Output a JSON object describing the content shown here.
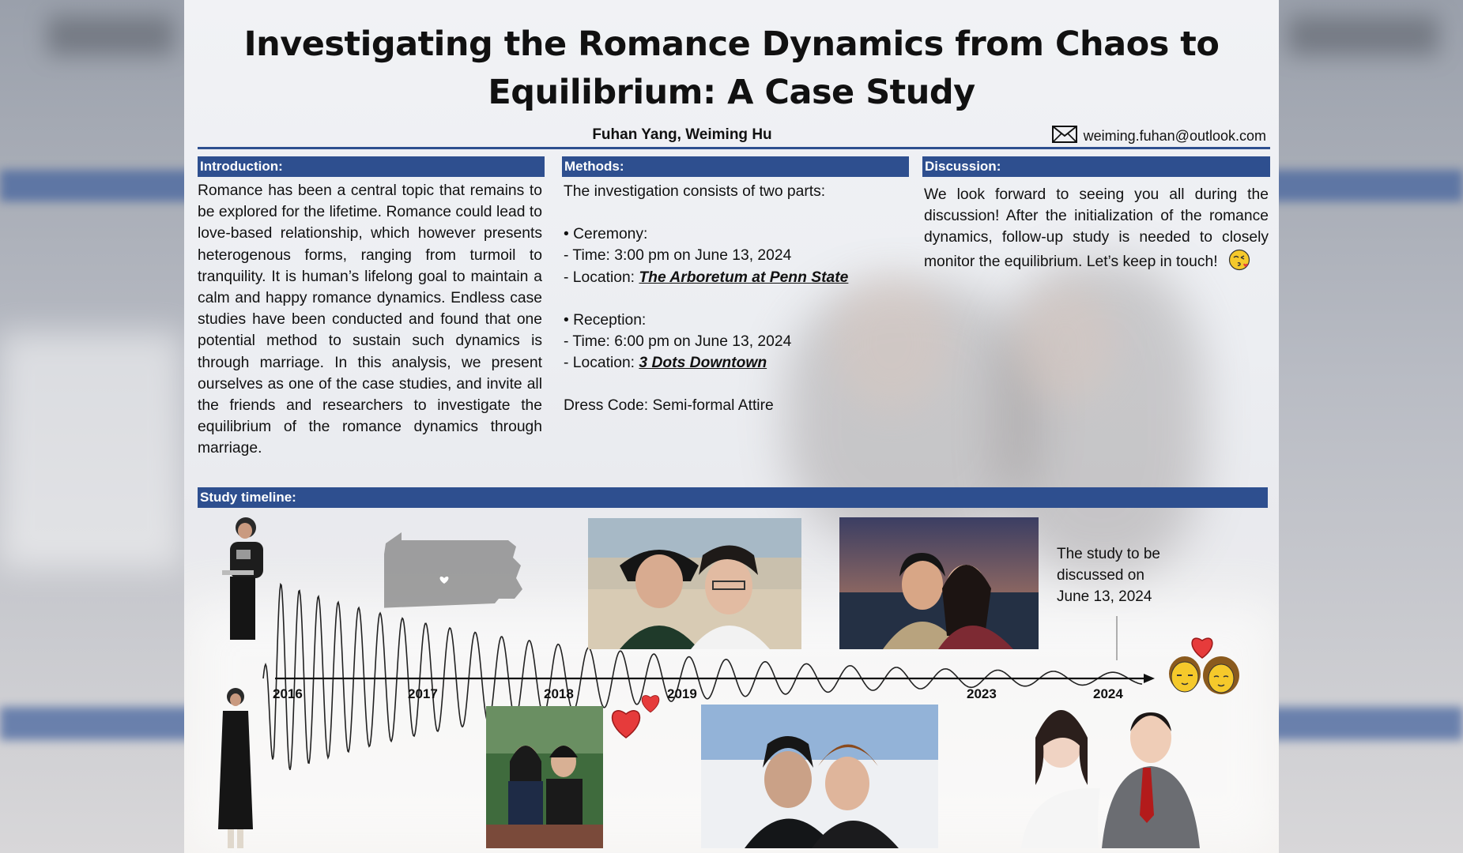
{
  "poster": {
    "title_line1": "Investigating the Romance Dynamics from Chaos to",
    "title_line2": "Equilibrium: A Case Study",
    "authors": "Fuhan Yang, Weiming Hu",
    "email": "weiming.fuhan@outlook.com",
    "email_icon": "envelope-icon"
  },
  "introduction": {
    "heading": "Introduction:",
    "text": "Romance has been a central topic that remains to be explored for the lifetime. Romance could lead to love-based relationship, which however presents heterogenous forms, ranging from turmoil to tranquility. It is human’s lifelong goal to maintain a calm and happy romance dynamics. Endless case studies have been conducted and found that one potential method to sustain such dynamics is through marriage. In this analysis, we present ourselves as one of the case studies, and invite all the friends and researchers to investigate the equilibrium of the romance dynamics through marriage."
  },
  "methods": {
    "heading": "Methods:",
    "intro": "The investigation consists of two parts:",
    "ceremony_label": "•  Ceremony:",
    "ceremony_time": "-  Time: 3:00 pm on June 13, 2024",
    "ceremony_location_label": "-  Location: ",
    "ceremony_location": "The Arboretum at Penn State",
    "reception_label": "•  Reception:",
    "reception_time": "-  Time: 6:00 pm on June 13, 2024",
    "reception_location_label": "-  Location: ",
    "reception_location": "3 Dots Downtown",
    "dress_code": "Dress Code: Semi-formal Attire"
  },
  "discussion": {
    "heading": "Discussion:",
    "text": "We look forward to seeing you all during the discussion! After the initialization of the romance dynamics, follow-up study is needed to closely monitor the equilibrium. Let’s keep in touch!",
    "emoji": "kissing-face-icon"
  },
  "timeline": {
    "heading": "Study timeline:",
    "years": [
      "2016",
      "2017",
      "2018",
      "2019",
      "2023",
      "2024"
    ],
    "callout": "The study to be discussed on June 13, 2024",
    "colors": {
      "accent": "#2e4f8f",
      "heart": "#e63b3b",
      "emoji_yellow": "#f5c92b"
    }
  }
}
